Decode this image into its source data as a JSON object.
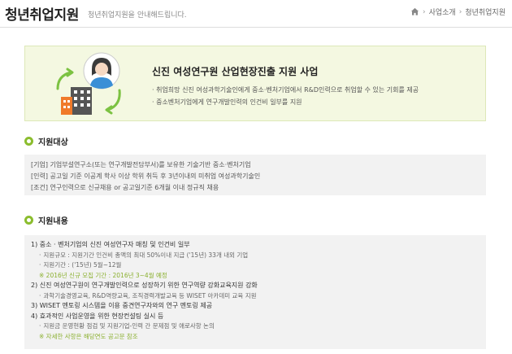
{
  "header": {
    "title": "청년취업지원",
    "description": "청년취업지원을 안내해드립니다.",
    "breadcrumb": [
      "사업소개",
      "청년취업지원"
    ]
  },
  "banner": {
    "title": "신진 여성연구원 산업현장진출 지원 사업",
    "points": [
      "· 취업희망 신진 여성과학기술인에게 중소·벤처기업에서 R&D인력으로 취업할 수 있는 기회를 제공",
      "· 중소벤처기업에게 연구개발인력의 인건비 일부를 지원"
    ]
  },
  "section_target": {
    "title": "지원대상",
    "lines": [
      "[기업] 기업부설연구소(또는 연구개발전담부서)를 보유한 기술기반 중소·벤처기업",
      "[인력] 공고일 기준 이공계 학사 이상 학위 취득 후 3년이내의 미취업 여성과학기술인",
      "[조건] 연구인력으로 신규채용 or 공고일기준 6개월 이내 정규직 채용"
    ]
  },
  "section_content": {
    "title": "지원내용",
    "items": [
      {
        "title": "1) 중소 · 벤처기업의 신진 여성연구자 매칭 및 인건비 일부",
        "subs": [
          "지원규모 : 지원기간 인건비 총액의 최대 50%이내 지급 ('15년) 33개 내외 기업",
          "지원기간 : ('15년) 5월~12월"
        ],
        "note": "※ 2016년 신규 모집 기간 : 2016년 3~4월 예정"
      },
      {
        "title": "2) 신진 여성연구원이 연구개발인력으로 성장하기 위한 연구역량 강화교육지원 강화",
        "subs": [
          "과학기술경영교육, R&D역량교육, 조직경력개발교육 등 WISET 아카데미 교육 지원"
        ],
        "note": ""
      },
      {
        "title": "3) WISET 멘토링 시스템을 이용 중견연구자와의 연구 멘토링 제공",
        "subs": [],
        "note": ""
      },
      {
        "title": "4) 효과적인 사업운영을 위한 현장컨설팅 실시 등",
        "subs": [
          "지원금 운영현황 점검 및 지원기업-인력 간 문제점 및 애로사항 논의"
        ],
        "note": "※ 자세한 사항은 해당연도 공고문 참조"
      }
    ]
  },
  "colors": {
    "accent": "#8bbd2e",
    "banner_bg": "#f4f8e1",
    "box_bg": "#f2f2f2",
    "note": "#8bb030"
  },
  "icons": [
    "home-icon",
    "woman-avatar-icon",
    "building-icon",
    "cycle-arrow-icon"
  ]
}
